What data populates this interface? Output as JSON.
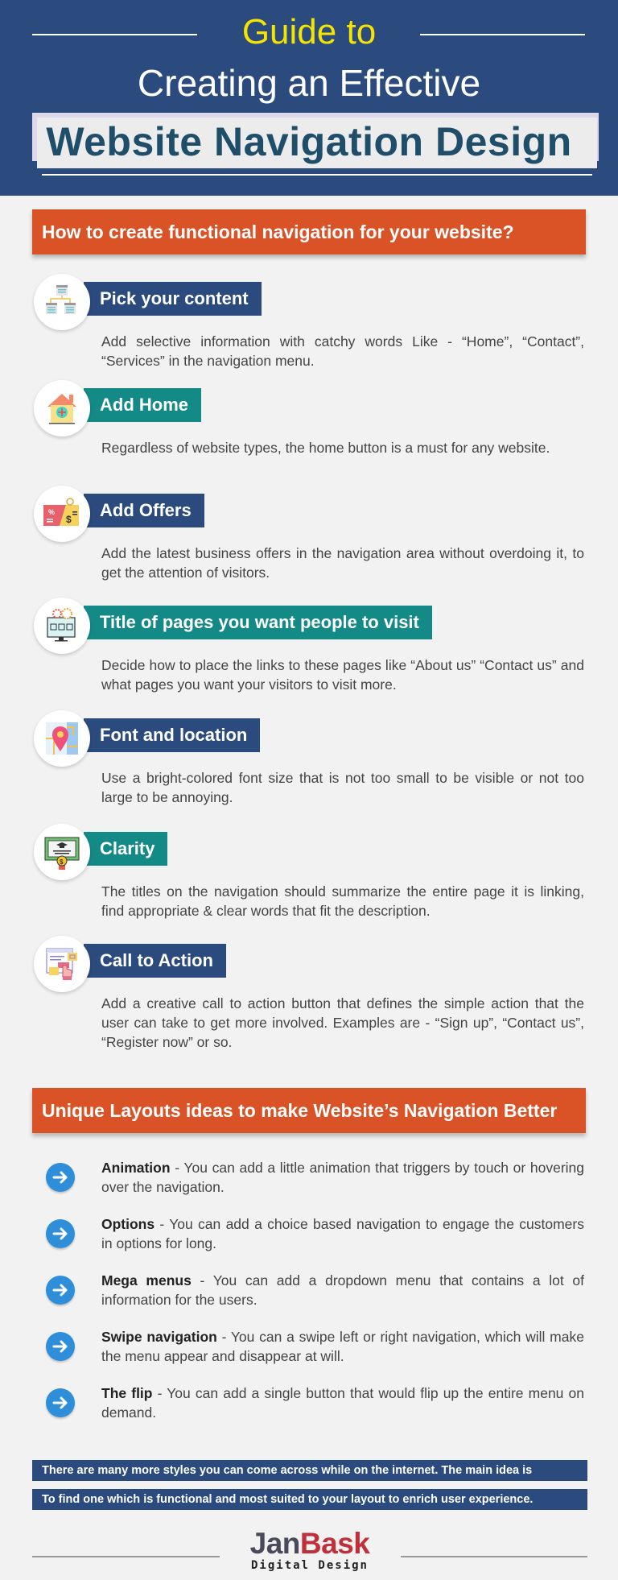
{
  "header": {
    "line1": "Guide to",
    "line2": "Creating an Effective",
    "line3": "Website Navigation Design"
  },
  "section1": {
    "title": "How to create functional navigation for your website?",
    "steps": [
      {
        "icon": "sitemap-icon",
        "label": "Pick your content",
        "color": "navy",
        "desc": "Add selective information with catchy words Like - “Home”, “Contact”, “Services” in the navigation menu."
      },
      {
        "icon": "home-add-icon",
        "label": "Add Home",
        "color": "teal",
        "desc": "Regardless of website types, the home button is a must for any website."
      },
      {
        "icon": "offer-ticket-icon",
        "label": "Add Offers",
        "color": "navy",
        "desc": "Add the latest business offers in the navigation area without overdoing it, to get the attention of visitors."
      },
      {
        "icon": "monitor-gears-icon",
        "label": "Title of pages you want people to visit",
        "color": "teal",
        "desc": "Decide how to place the links to these pages like “About us” “Contact us” and what pages you want your visitors to visit more."
      },
      {
        "icon": "map-pin-icon",
        "label": "Font and location",
        "color": "navy",
        "desc": "Use a bright-colored font size that is not too small to be visible or not too large to be annoying."
      },
      {
        "icon": "certificate-icon",
        "label": "Clarity",
        "color": "teal",
        "desc": "The titles on the navigation should summarize the entire page it is linking, find appropriate & clear words that fit the description."
      },
      {
        "icon": "click-action-icon",
        "label": "Call to Action",
        "color": "navy",
        "desc": "Add a creative call to action button that defines the simple action that the user can take to get more involved. Examples are - “Sign up”, “Contact us”, “Register now” or so."
      }
    ]
  },
  "section2": {
    "title": "Unique Layouts ideas to make Website’s Navigation Better",
    "ideas": [
      {
        "title": "Animation",
        "text": " - You can add a little animation that triggers by touch or hovering over the navigation."
      },
      {
        "title": "Options",
        "text": " - You can add a choice based navigation to engage the customers in options for long."
      },
      {
        "title": "Mega menus",
        "text": "  - You can add a dropdown menu that contains a lot of information for the users."
      },
      {
        "title": "Swipe navigation",
        "text": "  - You can a swipe left or right navigation, which will make the menu appear and disappear at will."
      },
      {
        "title": "The flip",
        "text": " - You can add a single button that would flip up the entire menu on demand."
      }
    ]
  },
  "footer": {
    "line1": "There are many more styles you can come across while on the internet. The main idea is",
    "line2": "To find one which is functional and most suited to your layout to enrich user experience.",
    "logo_part1": "Jan",
    "logo_part2": "Bask",
    "logo_sub": "Digital Design"
  },
  "colors": {
    "navy": "#2b4a7e",
    "teal": "#148a87",
    "orange": "#d95327",
    "yellow": "#f5e400",
    "arrow_blue": "#2f8ed9",
    "logo_red": "#c0303a"
  }
}
